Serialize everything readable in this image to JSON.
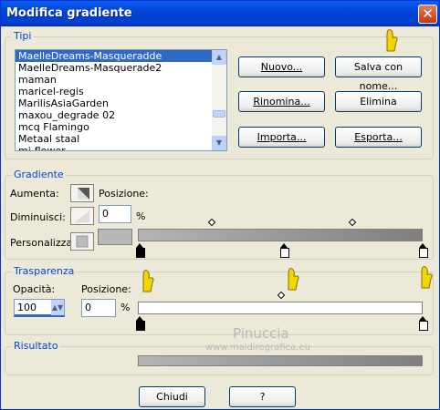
{
  "window": {
    "title": "Modifica gradiente",
    "close_symbol": "✕"
  },
  "tipi": {
    "legend": "Tipi",
    "items": [
      "MaelleDreams-Masqueradde",
      "MaelleDreams-Masquerade2",
      "maman",
      "maricel-regis",
      "MarilisAsiaGarden",
      "maxou_degrade 02",
      "mcq Flamingo",
      "Metaal staal",
      "mi-flower"
    ],
    "selected_index": 0,
    "buttons": {
      "nuovo": "Nuovo...",
      "salva": "Salva con nome...",
      "rinomina": "Rinomina...",
      "elimina": "Elimina",
      "importa": "Importa...",
      "esporta": "Esporta..."
    }
  },
  "gradiente": {
    "legend": "Gradiente",
    "aumenta_label": "Aumenta:",
    "diminuisci_label": "Diminuisci:",
    "personalizza_label": "Personalizza:",
    "posizione_label": "Posizione:",
    "posizione_value": "0",
    "percent": "%"
  },
  "trasparenza": {
    "legend": "Trasparenza",
    "opacita_label": "Opacità:",
    "opacita_value": "100",
    "posizione_label": "Posizione:",
    "posizione_value": "0",
    "percent": "%"
  },
  "risultato": {
    "legend": "Risultato"
  },
  "footer": {
    "chiudi": "Chiudi",
    "help": "?"
  },
  "watermark": {
    "name": "Pinuccia",
    "url": "www.maidiregrafica.eu"
  },
  "colors": {
    "accent": "#0046d5",
    "selection": "#316ac5",
    "gradient_start": "#b4b4b4",
    "gradient_end": "#7f7f7f"
  }
}
